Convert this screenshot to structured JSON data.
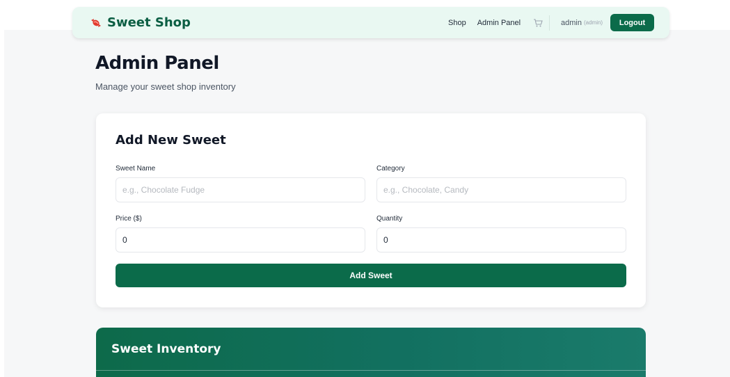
{
  "navbar": {
    "brand_name": "Sweet Shop",
    "brand_icon": "candy-icon",
    "links": {
      "shop": "Shop",
      "admin_panel": "Admin Panel"
    },
    "cart_icon": "cart-icon",
    "user": {
      "name": "admin",
      "role": "(admin)"
    },
    "logout_label": "Logout"
  },
  "page": {
    "title": "Admin Panel",
    "subtitle": "Manage your sweet shop inventory"
  },
  "add_form": {
    "title": "Add New Sweet",
    "name": {
      "label": "Sweet Name",
      "placeholder": "e.g., Chocolate Fudge",
      "value": ""
    },
    "category": {
      "label": "Category",
      "placeholder": "e.g., Chocolate, Candy",
      "value": ""
    },
    "price": {
      "label": "Price ($)",
      "value": "0"
    },
    "quantity": {
      "label": "Quantity",
      "value": "0"
    },
    "submit_label": "Add Sweet"
  },
  "inventory": {
    "title": "Sweet Inventory"
  },
  "colors": {
    "brand": "#0b6b4a",
    "navbar_bg": "#e9f8f2",
    "page_bg": "#f6f7f8"
  }
}
